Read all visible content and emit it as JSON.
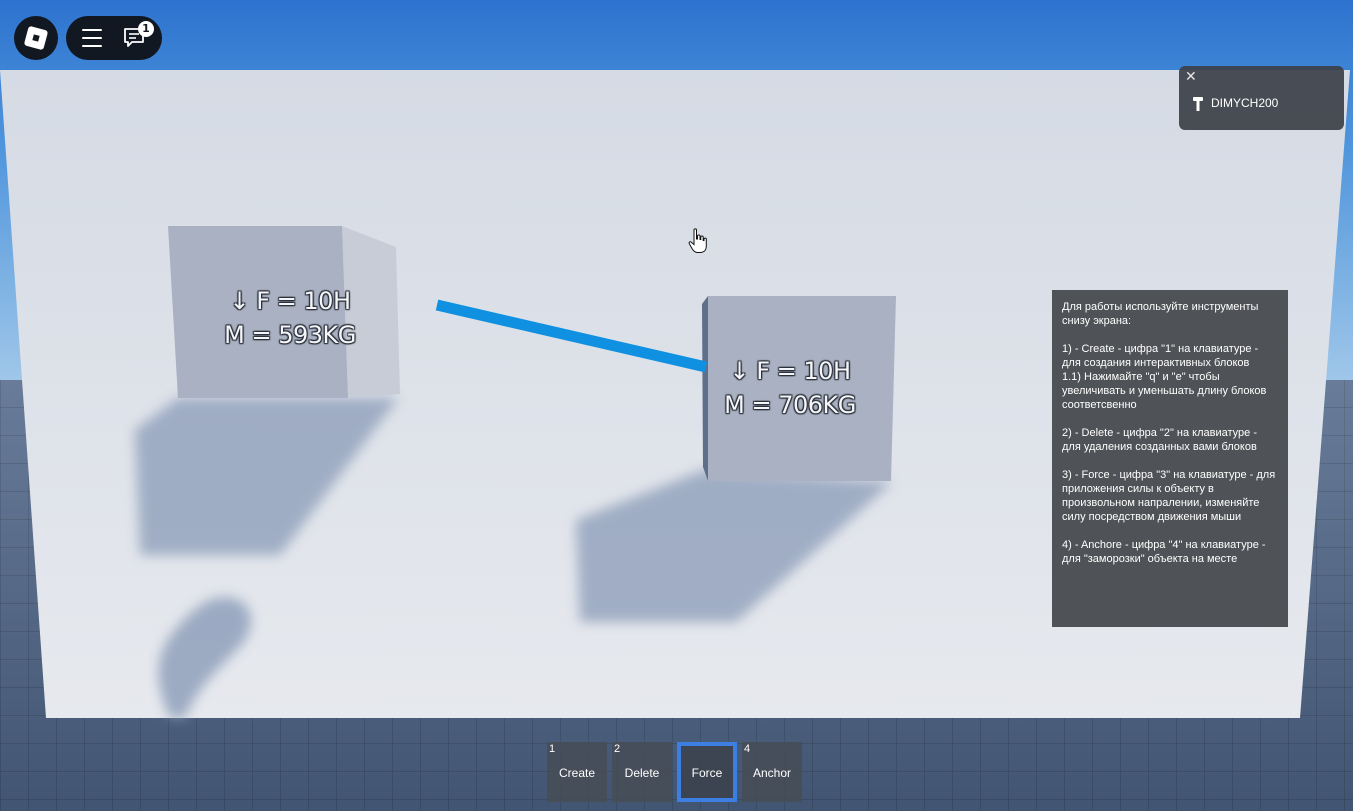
{
  "topbar": {
    "chat_badge_count": "1"
  },
  "player_panel": {
    "close_symbol": "✕",
    "username": "DIMYCH200"
  },
  "blocks": [
    {
      "force_line": "↓ F = 10H",
      "mass_line": "M = 593KG"
    },
    {
      "force_line": "↓ F = 10H",
      "mass_line": "M = 706KG"
    }
  ],
  "instructions": {
    "intro": "Для работы используйте инструменты снизу экрана:",
    "create": "1) - Create -  цифра \"1\" на клавиатуре - для создания интерактивных блоков",
    "create_sub": "1.1) Нажимайте \"q\" и \"e\" чтобы увеличивать и уменьшать длину блоков соответсвенно",
    "delete": "2) - Delete - цифра \"2\" на клавиатуре - для удаления созданных вами блоков",
    "force": "3) - Force - цифра \"3\" на клавиатуре - для приложения силы к объекту в произвольном напралении, изменяйте силу посредством движения мыши",
    "anchor": "4) - Anchore - цифра \"4\" на клавиатуре - для \"заморозки\" объекта на месте"
  },
  "hotbar": {
    "slots": [
      {
        "number": "1",
        "label": "Create",
        "active": false
      },
      {
        "number": "2",
        "label": "Delete",
        "active": false
      },
      {
        "number": "",
        "label": "Force",
        "active": true
      },
      {
        "number": "4",
        "label": "Anchor",
        "active": false
      }
    ]
  },
  "colors": {
    "beam": "#0f90e0",
    "active_slot_border": "#3d7fe0",
    "panel_bg": "#4f5256"
  }
}
